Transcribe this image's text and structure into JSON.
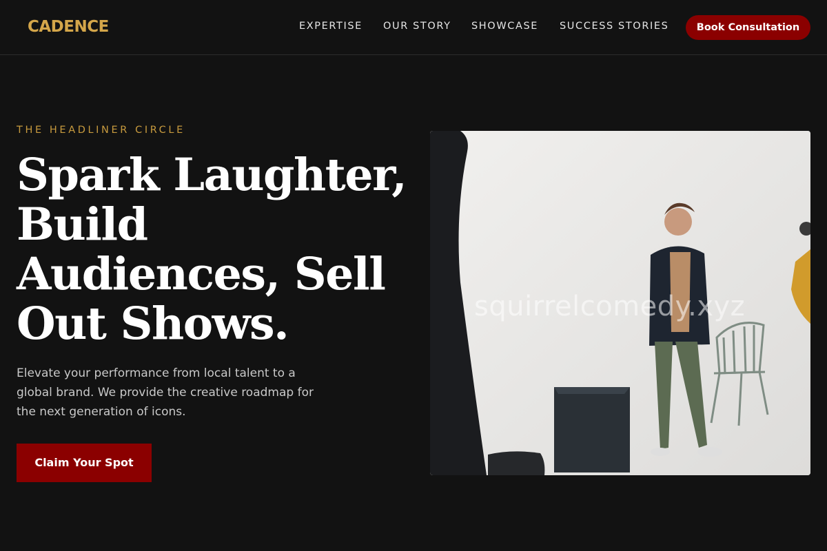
{
  "brand": {
    "name": "CADENCE",
    "color": "#d4a64a"
  },
  "nav": {
    "items": [
      {
        "label": "EXPERTISE"
      },
      {
        "label": "OUR STORY"
      },
      {
        "label": "SHOWCASE"
      },
      {
        "label": "SUCCESS STORIES"
      }
    ],
    "cta_label": "Book Consultation"
  },
  "hero": {
    "eyebrow": "THE HEADLINER CIRCLE",
    "headline_lines": [
      "Spark Laughter,",
      "Build",
      "Audiences, Sell",
      "Out Shows."
    ],
    "description": "Elevate your performance from local talent to a global brand. We provide the creative roadmap for the next generation of icons.",
    "cta_label": "Claim Your Spot",
    "image_watermark": "squirrelcomedy.xyz"
  },
  "colors": {
    "background": "#121212",
    "accent_red": "#8b0000",
    "accent_gold": "#c79a3e",
    "text_muted": "#c9c9c9"
  }
}
